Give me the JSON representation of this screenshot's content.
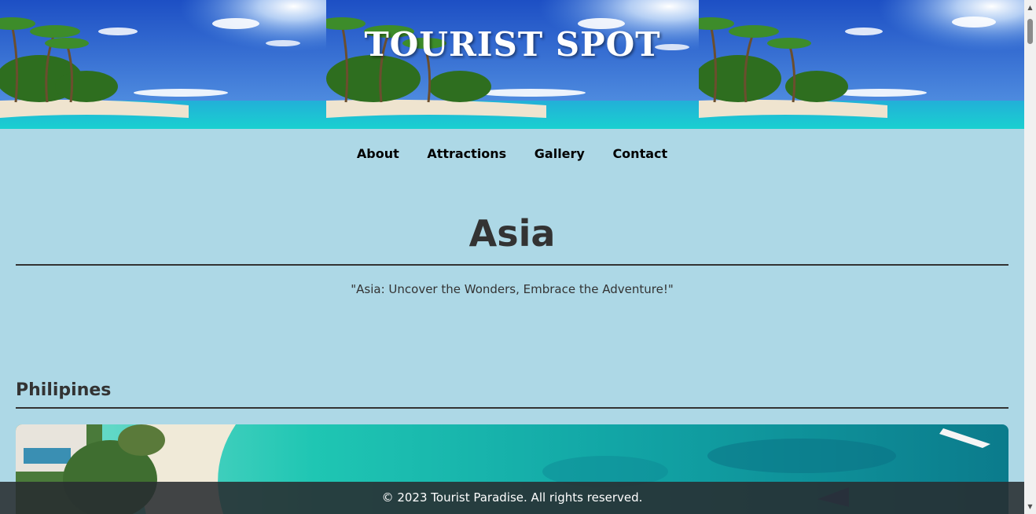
{
  "header": {
    "title": "TOURIST SPOT",
    "banner_image": "tropical-beach-palm-trees"
  },
  "nav": {
    "items": [
      "About",
      "Attractions",
      "Gallery",
      "Contact"
    ]
  },
  "region": {
    "title": "Asia",
    "tagline": "\"Asia: Uncover the Wonders, Embrace the Adventure!\""
  },
  "country": {
    "title": "Philipines",
    "photo": "aerial-beach-turquoise-water"
  },
  "footer": {
    "text": "© 2023 Tourist Paradise. All rights reserved."
  },
  "colors": {
    "page_background": "#add8e6",
    "heading_text": "#333333",
    "footer_background": "#282c30"
  },
  "scrollbar": {
    "up_icon": "scroll-up-arrow",
    "down_icon": "scroll-down-arrow"
  }
}
